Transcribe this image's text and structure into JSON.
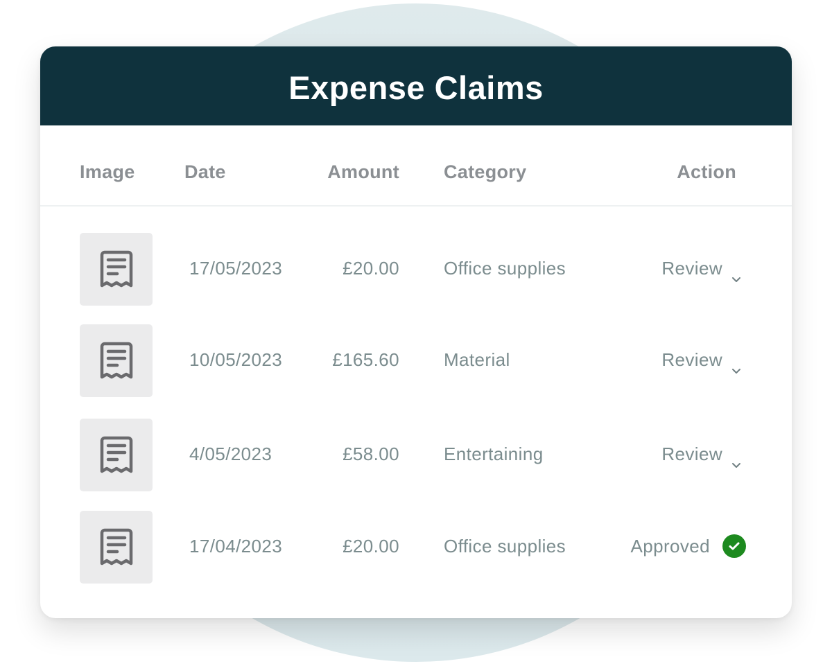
{
  "title": "Expense Claims",
  "columns": {
    "image": "Image",
    "date": "Date",
    "amount": "Amount",
    "category": "Category",
    "action": "Action"
  },
  "rows": [
    {
      "icon": "receipt-icon",
      "date": "17/05/2023",
      "amount": "£20.00",
      "category": "Office supplies",
      "action": "Review",
      "status": "review"
    },
    {
      "icon": "receipt-icon",
      "date": "10/05/2023",
      "amount": "£165.60",
      "category": "Material",
      "action": "Review",
      "status": "review"
    },
    {
      "icon": "receipt-icon",
      "date": "4/05/2023",
      "amount": "£58.00",
      "category": "Entertaining",
      "action": "Review",
      "status": "review"
    },
    {
      "icon": "receipt-icon",
      "date": "17/04/2023",
      "amount": "£20.00",
      "category": "Office supplies",
      "action": "Approved",
      "status": "approved"
    }
  ],
  "colors": {
    "header_bg": "#0f323d",
    "approved_green": "#1d8a1f",
    "text_muted": "#7b8c8e",
    "column_header": "#8b8f93"
  }
}
